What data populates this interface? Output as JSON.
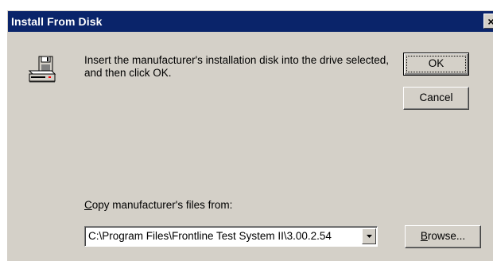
{
  "window": {
    "title": "Install From Disk",
    "close_glyph": "×"
  },
  "icons": {
    "disk": "floppy-disk-drive-icon",
    "dropdown": "chevron-down-icon"
  },
  "message": {
    "text": "Insert the manufacturer's installation disk into the drive selected, and then click OK."
  },
  "buttons": {
    "ok_label": "OK",
    "cancel_label": "Cancel",
    "browse_accel": "B",
    "browse_rest": "rowse..."
  },
  "copy_from": {
    "label_accel": "C",
    "label_rest": "opy manufacturer's files from:",
    "value": "C:\\Program Files\\Frontline Test System II\\3.00.2.54"
  },
  "colors": {
    "title_bar": "#0a246a",
    "face": "#d4d0c8"
  }
}
